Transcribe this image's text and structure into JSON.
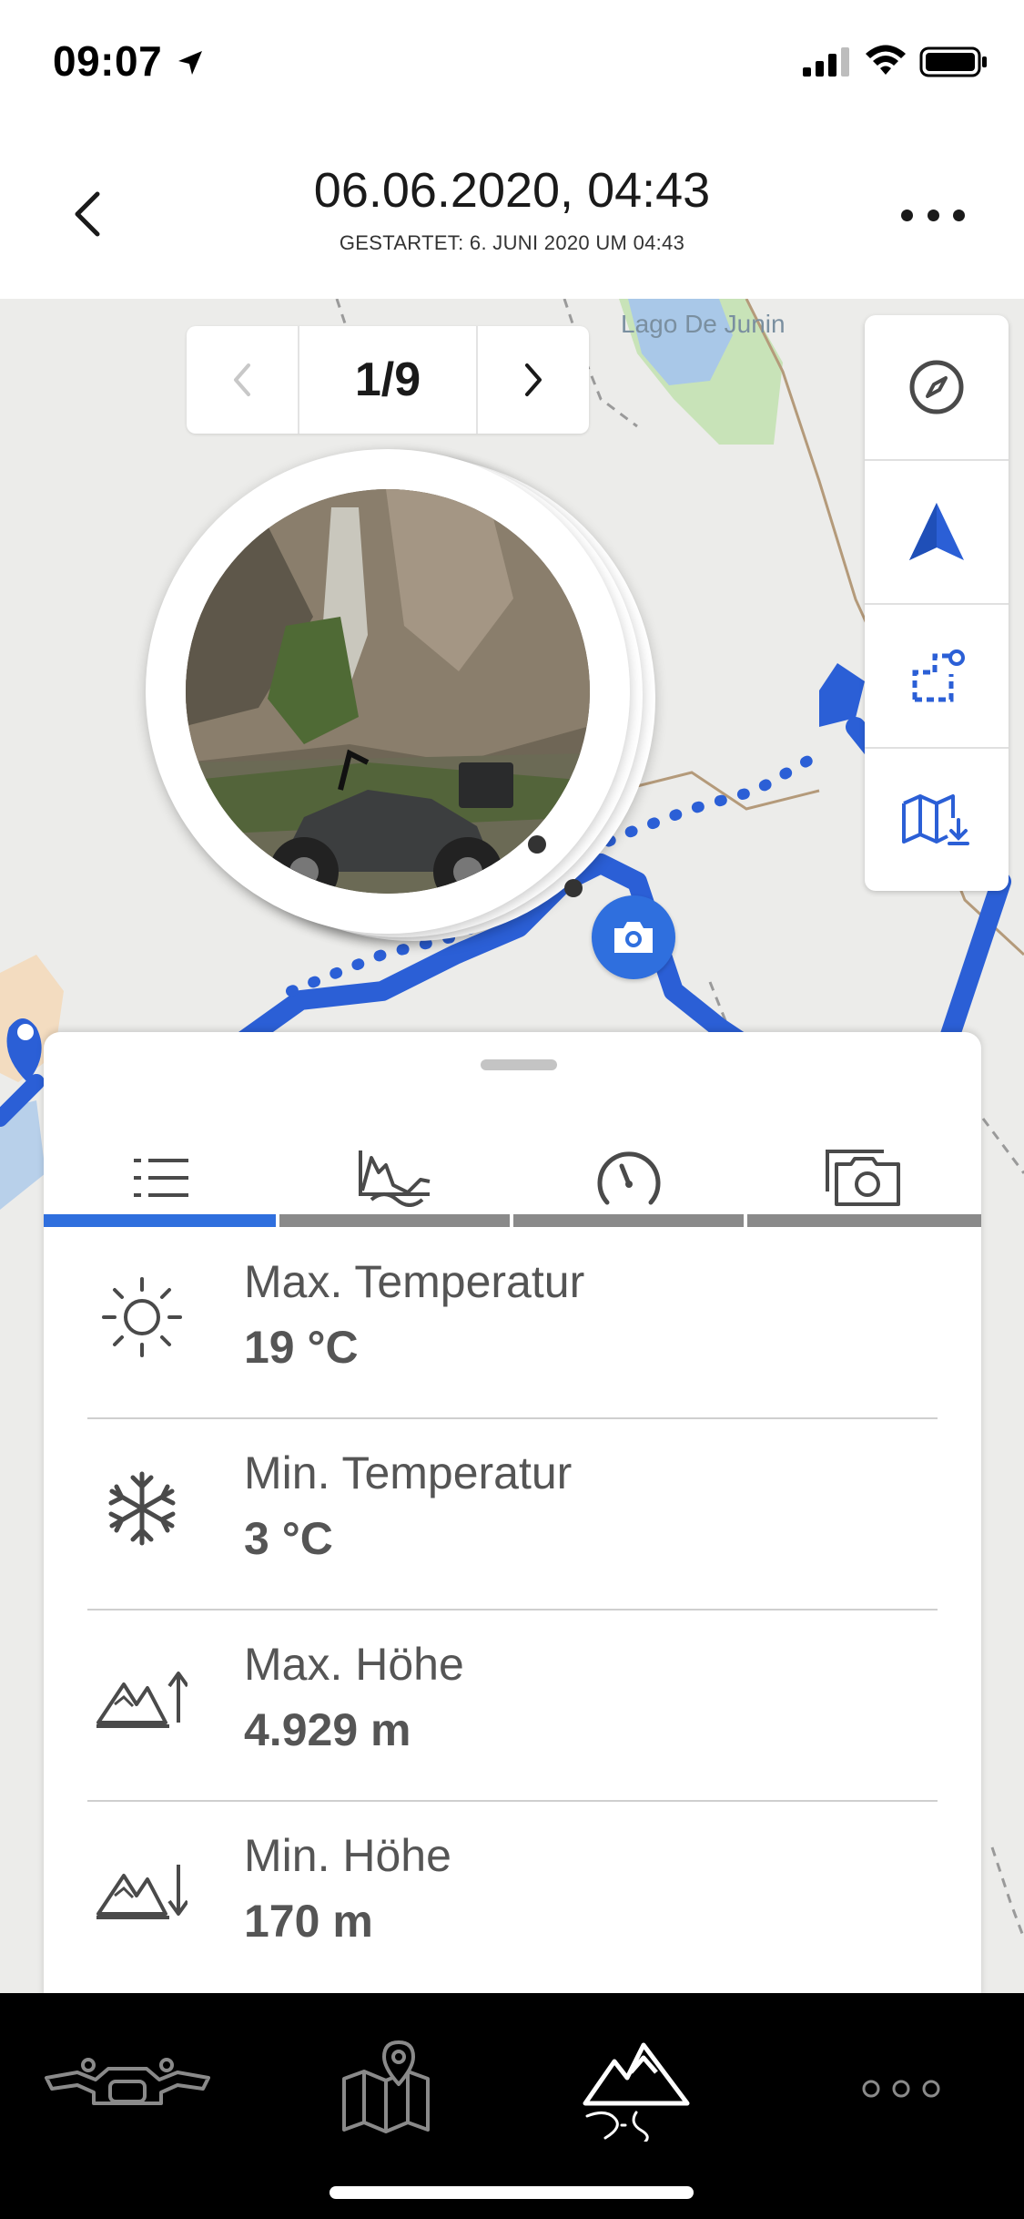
{
  "status_bar": {
    "time": "09:07"
  },
  "header": {
    "title": "06.06.2020, 04:43",
    "subtitle": "GESTARTET: 6. JUNI 2020 UM 04:43"
  },
  "map": {
    "place_label": "Lago De Junin",
    "pager": {
      "count": "1/9"
    }
  },
  "tabs": [
    {
      "icon": "list-icon",
      "active": true
    },
    {
      "icon": "elevation-chart-icon",
      "active": false
    },
    {
      "icon": "speedometer-icon",
      "active": false
    },
    {
      "icon": "photos-icon",
      "active": false
    }
  ],
  "stats": [
    {
      "icon": "sun-icon",
      "label": "Max. Temperatur",
      "value": "19 °C"
    },
    {
      "icon": "snowflake-icon",
      "label": "Min. Temperatur",
      "value": "3 °C"
    },
    {
      "icon": "mountain-up-icon",
      "label": "Max. Höhe",
      "value": "4.929 m"
    },
    {
      "icon": "mountain-down-icon",
      "label": "Min. Höhe",
      "value": "170 m"
    }
  ],
  "colors": {
    "accent": "#2f6fde",
    "route": "#2b5fd6",
    "nav_background": "#000000"
  },
  "bottom_nav": [
    {
      "icon": "motorcycle-icon"
    },
    {
      "icon": "map-pin-icon"
    },
    {
      "icon": "mountain-road-icon",
      "active": true
    },
    {
      "icon": "more-dots-icon"
    }
  ]
}
